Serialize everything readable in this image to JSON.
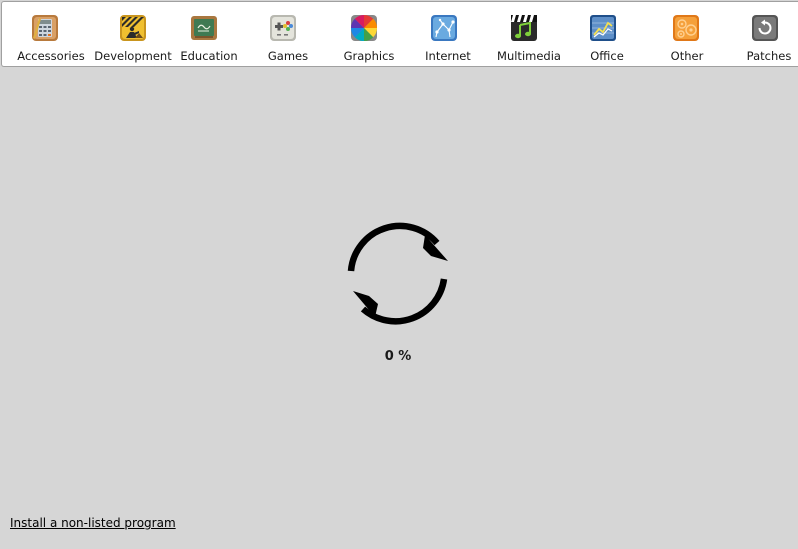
{
  "categories": [
    {
      "label": "Accessories",
      "icon": "accessories-icon"
    },
    {
      "label": "Development",
      "icon": "development-icon"
    },
    {
      "label": "Education",
      "icon": "education-icon"
    },
    {
      "label": "Games",
      "icon": "games-icon"
    },
    {
      "label": "Graphics",
      "icon": "graphics-icon"
    },
    {
      "label": "Internet",
      "icon": "internet-icon"
    },
    {
      "label": "Multimedia",
      "icon": "multimedia-icon"
    },
    {
      "label": "Office",
      "icon": "office-icon"
    },
    {
      "label": "Other",
      "icon": "other-icon"
    },
    {
      "label": "Patches",
      "icon": "patches-icon"
    }
  ],
  "loading": {
    "progress_text": "0 %",
    "progress": 0,
    "icon": "refresh-icon"
  },
  "footer": {
    "install_link": "Install a non-listed program"
  },
  "colors": {
    "background": "#d6d6d6",
    "bar_background": "#ffffff",
    "spinner": "#000000"
  }
}
